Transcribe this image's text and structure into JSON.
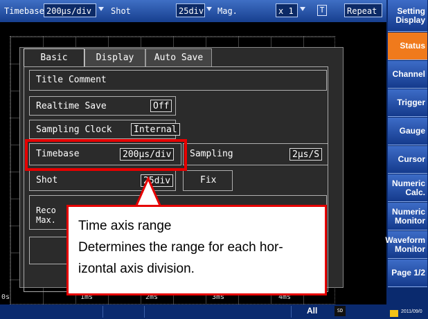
{
  "topbar": {
    "timebase_label": "Timebase",
    "timebase_value": "200μs/div",
    "shot_label": "Shot",
    "shot_value": "25div",
    "mag_label": "Mag.",
    "mag_value": "x 1",
    "trigger_mode": "Repeat"
  },
  "side_menu": {
    "items": [
      {
        "label": "Setting\nDisplay",
        "active": false
      },
      {
        "label": "Status",
        "active": true
      },
      {
        "label": "Channel",
        "active": false
      },
      {
        "label": "Trigger",
        "active": false
      },
      {
        "label": "Gauge",
        "active": false
      },
      {
        "label": "Cursor",
        "active": false
      },
      {
        "label": "Numeric\nCalc.",
        "active": false
      },
      {
        "label": "Numeric\nMonitor",
        "active": false
      },
      {
        "label": "Waveform\nMonitor",
        "active": false
      },
      {
        "label": "Page 1/2",
        "active": false
      }
    ]
  },
  "time_axis": {
    "ticks": [
      "0s",
      "1ms",
      "2ms",
      "3ms",
      "4ms"
    ]
  },
  "dialog": {
    "tabs": [
      {
        "label": "Basic",
        "active": true
      },
      {
        "label": "Display",
        "active": false
      },
      {
        "label": "Auto Save",
        "active": false
      }
    ],
    "title_comment": "Title Comment",
    "realtime_save_label": "Realtime Save",
    "realtime_save_value": "Off",
    "sampling_clock_label": "Sampling Clock",
    "sampling_clock_value": "Internal",
    "timebase_label": "Timebase",
    "timebase_value": "200μs/div",
    "sampling_label": "Sampling",
    "sampling_value": "2μs/S",
    "shot_label": "Shot",
    "shot_value": "25div",
    "fix_label": "Fix",
    "record_label": "Reco",
    "max_label": "Max."
  },
  "callout": {
    "title": "Time axis range",
    "line1": "Determines the range for each hor-",
    "line2": "izontal axis division."
  },
  "status_bar": {
    "all_label": "All",
    "sd_label": "SD",
    "date": "2011/09/0"
  },
  "colors": {
    "accent_active": "#f07a1c",
    "highlight": "#e60000",
    "panel_blue": "#173f8f"
  }
}
